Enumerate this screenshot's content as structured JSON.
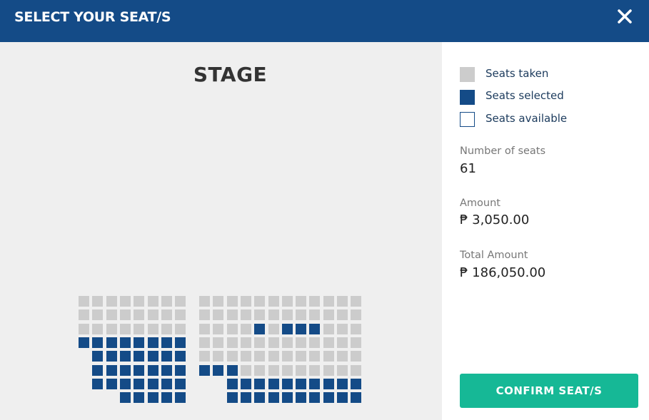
{
  "header": {
    "title": "SELECT YOUR SEAT/S"
  },
  "map": {
    "stage_label": "STAGE"
  },
  "legend": {
    "taken": "Seats taken",
    "selected": "Seats selected",
    "available": "Seats available"
  },
  "summary": {
    "seats_label": "Number of seats",
    "seats_value": "61",
    "amount_label": "Amount",
    "amount_value": "₱ 3,050.00",
    "total_label": "Total Amount",
    "total_value": "₱ 186,050.00"
  },
  "actions": {
    "confirm_label": "CONFIRM SEAT/S"
  },
  "colors": {
    "header": "#144b87",
    "seat_taken": "#cccccc",
    "seat_selected": "#144b87",
    "confirm": "#16b896"
  },
  "seating": {
    "legend_codes": {
      "T": "taken",
      "S": "selected",
      ".": "no seat"
    },
    "left_section": [
      "TTTTTTTT",
      "TTTTTTTT",
      "TTTTTTTT",
      "SSSSSSSS",
      ".SSSSSSS",
      ".SSSSSSS",
      ".SSSSSSS",
      "...SSSSS"
    ],
    "right_section": [
      "TTTTTTTTTTTT",
      "TTTTTTTTTTTT",
      "TTTTSTSSSTTT",
      "TTTTTTTTTTTT",
      "TTTTTTTTTTTT",
      "SSSTTTTTTTTT",
      "..SSSSSSSSSS",
      "..SSSSSSSSSS"
    ]
  }
}
